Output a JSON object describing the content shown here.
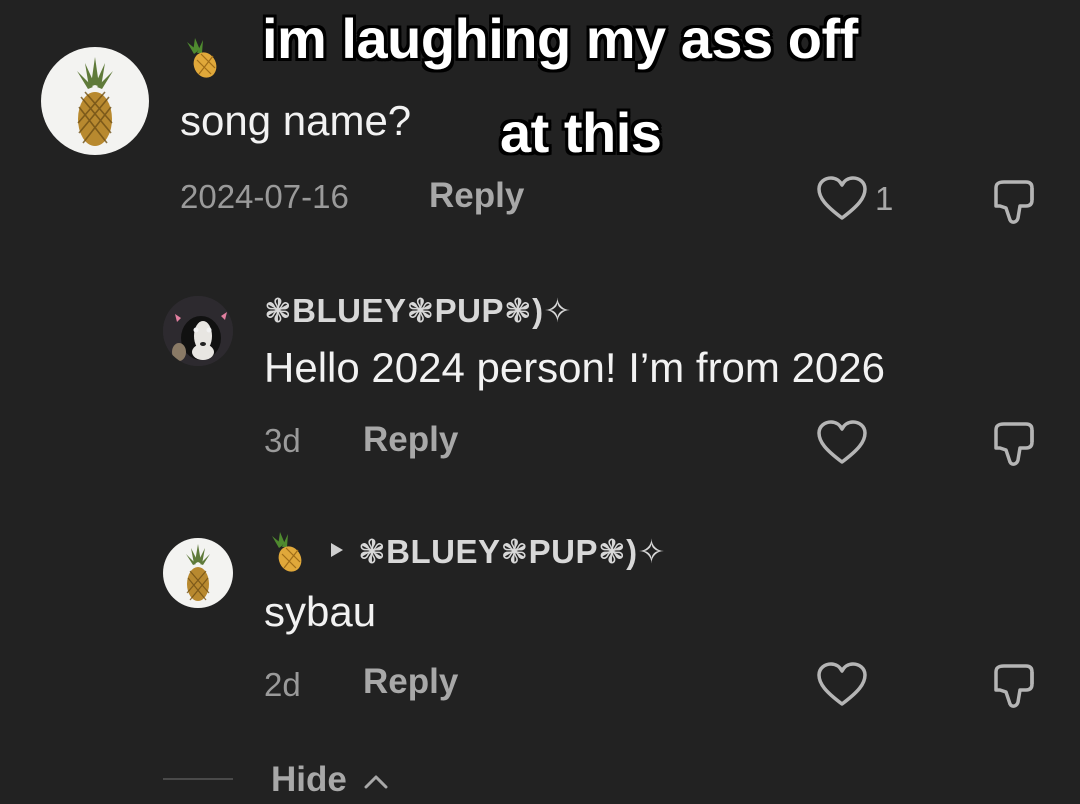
{
  "caption": {
    "line1": "im laughing my ass off",
    "line2": "at this"
  },
  "comments": [
    {
      "avatar_icon": "pineapple-icon",
      "username_icon": "pineapple-emoji-icon",
      "text": "song name?",
      "date": "2024-07-16",
      "reply_label": "Reply",
      "like_count": "1"
    },
    {
      "avatar_icon": "dog-avatar",
      "username": "❃BLUEY❃PUP❃)✧",
      "text": "Hello 2024 person! I’m from 2026",
      "date": "3d",
      "reply_label": "Reply"
    },
    {
      "avatar_icon": "pineapple-icon",
      "username_icon": "pineapple-emoji-icon",
      "reply_to": "❃BLUEY❃PUP❃)✧",
      "text": "sybau",
      "date": "2d",
      "reply_label": "Reply"
    }
  ],
  "hide_label": "Hide",
  "colors": {
    "background": "#222222",
    "text": "#f2f2f2",
    "muted": "#9a9a9a"
  }
}
